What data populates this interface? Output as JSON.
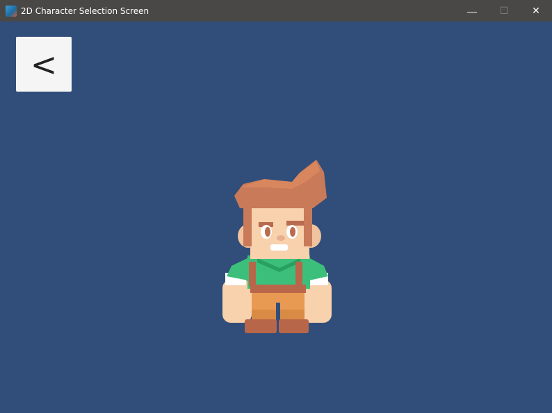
{
  "window": {
    "title": "2D Character Selection Screen",
    "icon": "app-icon",
    "controls": {
      "minimize": "—",
      "maximize": "☐",
      "close": "✕"
    }
  },
  "main": {
    "back_button_label": "<",
    "character": "boy-character-sprite"
  },
  "colors": {
    "background": "#314e7a",
    "titlebar": "#4a4846",
    "button": "#f5f5f5"
  }
}
